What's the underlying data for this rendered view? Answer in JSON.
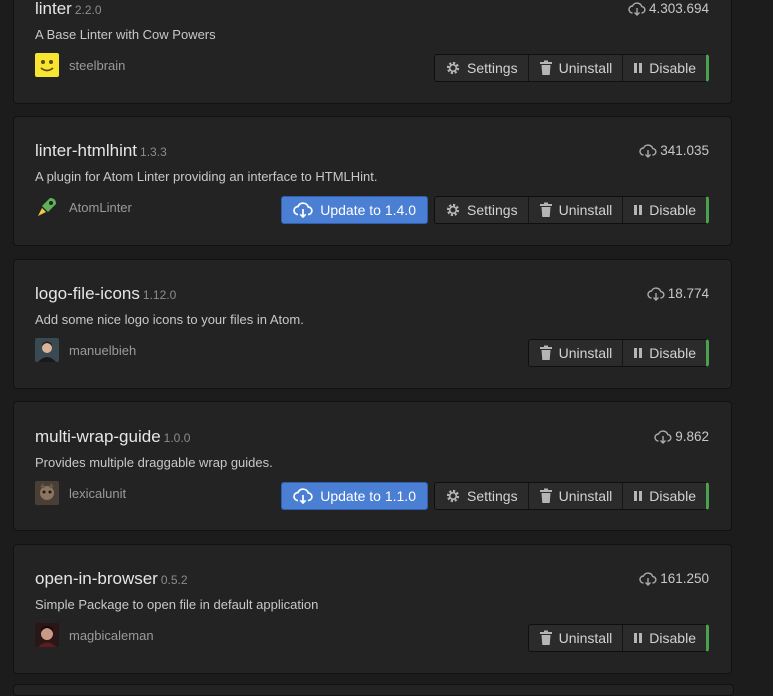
{
  "labels": {
    "settings": "Settings",
    "uninstall": "Uninstall",
    "disable": "Disable"
  },
  "packages": [
    {
      "name": "linter",
      "version": "2.2.0",
      "description": "A Base Linter with Cow Powers",
      "downloads": "4.303.694",
      "author": "steelbrain",
      "update_label": "",
      "has_settings": true
    },
    {
      "name": "linter-htmlhint",
      "version": "1.3.3",
      "description": "A plugin for Atom Linter providing an interface to HTMLHint.",
      "downloads": "341.035",
      "author": "AtomLinter",
      "update_label": "Update to 1.4.0",
      "has_settings": true
    },
    {
      "name": "logo-file-icons",
      "version": "1.12.0",
      "description": "Add some nice logo icons to your files in Atom.",
      "downloads": "18.774",
      "author": "manuelbieh",
      "update_label": "",
      "has_settings": false
    },
    {
      "name": "multi-wrap-guide",
      "version": "1.0.0",
      "description": "Provides multiple draggable wrap guides.",
      "downloads": "9.862",
      "author": "lexicalunit",
      "update_label": "Update to 1.1.0",
      "has_settings": true
    },
    {
      "name": "open-in-browser",
      "version": "0.5.2",
      "description": "Simple Package to open file in default application",
      "downloads": "161.250",
      "author": "magbicaleman",
      "update_label": "",
      "has_settings": false
    }
  ],
  "colors": {
    "background": "#1c1c1c",
    "card": "#232323",
    "update_button": "#4a7fd4",
    "enabled_indicator": "#4aa14e"
  }
}
